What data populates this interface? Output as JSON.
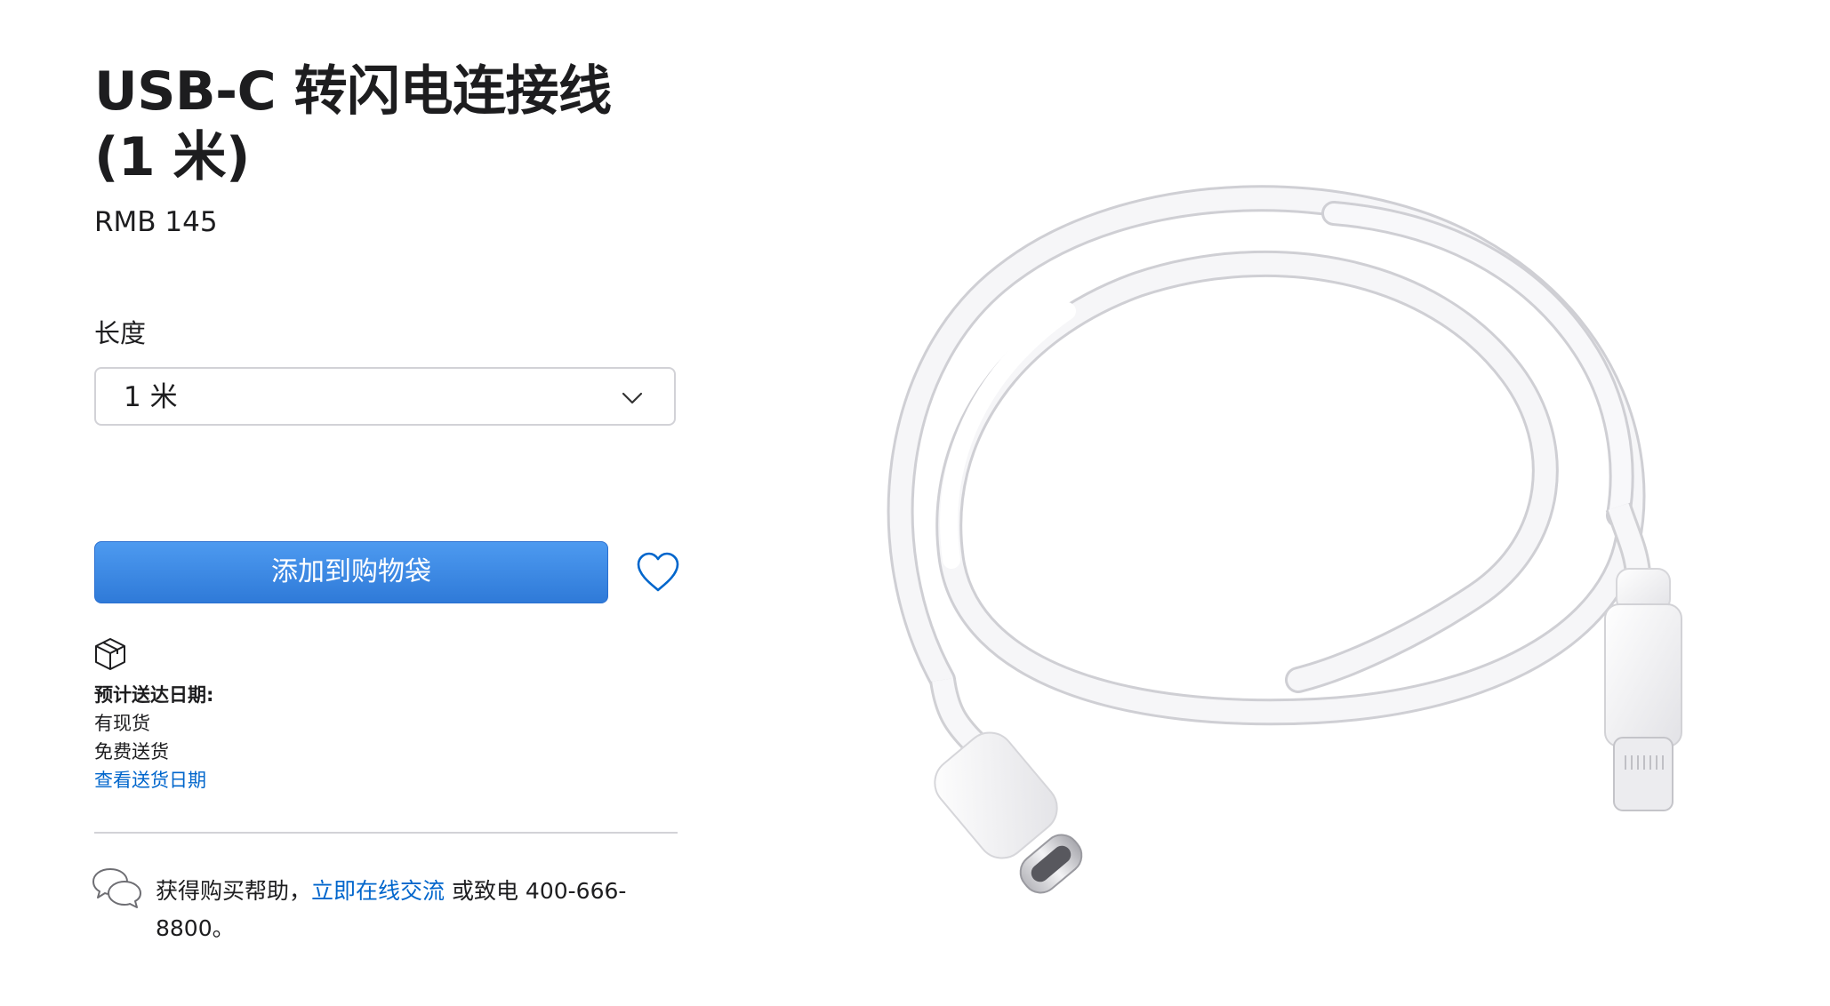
{
  "product": {
    "title_line1": "USB-C 转闪电连接线",
    "title_line2": "(1 米)",
    "price": "RMB 145",
    "image_alt": "USB-C 转闪电连接线"
  },
  "length": {
    "label": "长度",
    "selected": "1 米"
  },
  "actions": {
    "add_to_bag": "添加到购物袋"
  },
  "delivery": {
    "heading": "预计送达日期:",
    "stock": "有现货",
    "shipping": "免费送货",
    "link": "查看送货日期"
  },
  "help": {
    "prefix": "获得购买帮助，",
    "chat_link": "立即在线交流",
    "suffix": " 或致电 400-666-8800。"
  },
  "colors": {
    "accent": "#0066cc",
    "button": "#3a86e4",
    "text": "#1d1d1f",
    "border": "#d2d2d7"
  }
}
